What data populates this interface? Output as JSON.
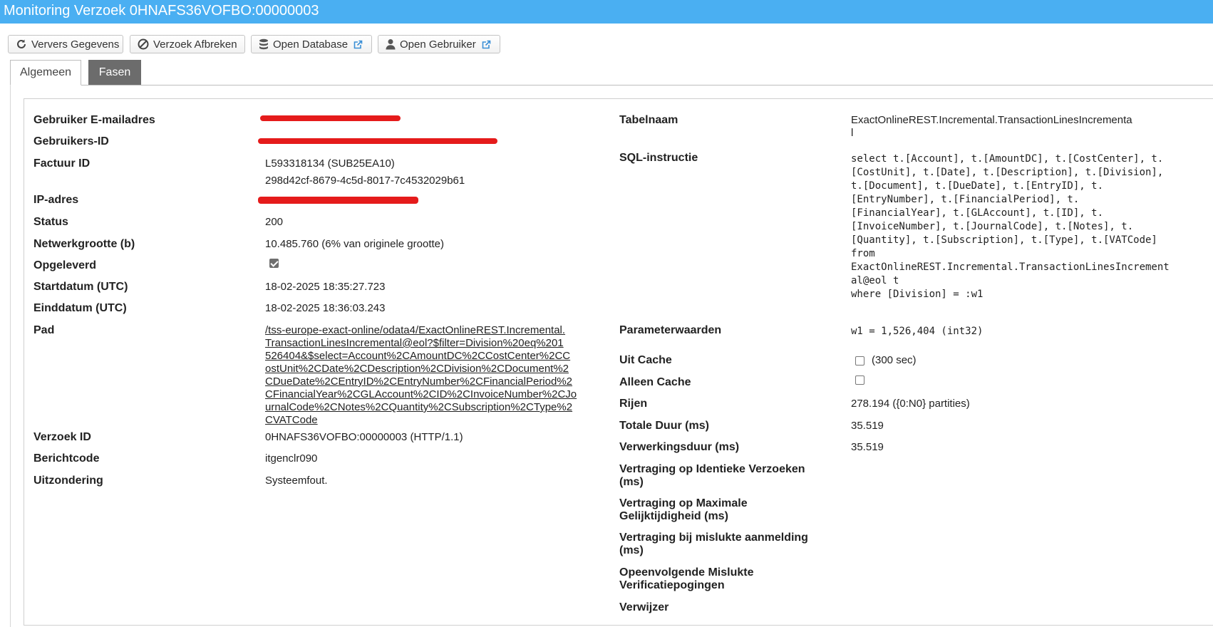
{
  "window": {
    "title": "Monitoring Verzoek 0HNAFS36VOFBO:00000003"
  },
  "toolbar": {
    "refresh_label": "Ververs Gegevens",
    "abort_label": "Verzoek Afbreken",
    "open_db_label": "Open Database",
    "open_user_label": "Open Gebruiker"
  },
  "tabs": {
    "general": "Algemeen",
    "phases": "Fasen"
  },
  "left": {
    "email_label": "Gebruiker E-mailadres",
    "userid_label": "Gebruikers-ID",
    "invoice_label": "Factuur ID",
    "invoice_line1": "L593318134 (SUB25EA10)",
    "invoice_line2": "298d42cf-8679-4c5d-8017-7c4532029b61",
    "ip_label": "IP-adres",
    "status_label": "Status",
    "status_value": "200",
    "network_label": "Netwerkgrootte (b)",
    "network_value": "10.485.760 (6% van originele grootte)",
    "delivered_label": "Opgeleverd",
    "delivered_checked": true,
    "start_label": "Startdatum (UTC)",
    "start_value": "18-02-2025 18:35:27.723",
    "end_label": "Einddatum (UTC)",
    "end_value": "18-02-2025 18:36:03.243",
    "path_label": "Pad",
    "path_lines": [
      "/tss-europe-exact-online/odata4/ExactOnlineREST.Incremental.",
      "TransactionLinesIncremental@eol?$filter=Division%20eq%201",
      "526404&$select=Account%2CAmountDC%2CCostCenter%2CC",
      "ostUnit%2CDate%2CDescription%2CDivision%2CDocument%2",
      "CDueDate%2CEntryID%2CEntryNumber%2CFinancialPeriod%2",
      "CFinancialYear%2CGLAccount%2CID%2CInvoiceNumber%2CJo",
      "urnalCode%2CNotes%2CQuantity%2CSubscription%2CType%2",
      "CVATCode"
    ],
    "request_id_label": "Verzoek ID",
    "request_id_value": "0HNAFS36VOFBO:00000003 (HTTP/1.1)",
    "msgcode_label": "Berichtcode",
    "msgcode_value": "itgenclr090",
    "exception_label": "Uitzondering",
    "exception_value": "Systeemfout."
  },
  "right": {
    "table_label": "Tabelnaam",
    "table_line1": "ExactOnlineREST.Incremental.TransactionLinesIncrementa",
    "table_line2": "l",
    "sql_label": "SQL-instructie",
    "sql_lines": [
      "select t.[Account], t.[AmountDC], t.[CostCenter], t.",
      "[CostUnit], t.[Date], t.[Description], t.[Division],",
      "t.[Document], t.[DueDate], t.[EntryID], t.",
      "[EntryNumber], t.[FinancialPeriod], t.",
      "[FinancialYear], t.[GLAccount], t.[ID], t.",
      "[InvoiceNumber], t.[JournalCode], t.[Notes], t.",
      "[Quantity], t.[Subscription], t.[Type], t.[VATCode]",
      "from",
      "ExactOnlineREST.Incremental.TransactionLinesIncrement",
      "al@eol t",
      "where  [Division] = :w1"
    ],
    "params_label": "Parameterwaarden",
    "params_value": "w1 = 1,526,404 (int32)",
    "from_cache_label": "Uit Cache",
    "from_cache_checked": false,
    "from_cache_note": "(300 sec)",
    "only_cache_label": "Alleen Cache",
    "only_cache_checked": false,
    "rows_label": "Rijen",
    "rows_value": "278.194 ({0:N0} partities)",
    "total_label": "Totale Duur (ms)",
    "total_value": "35.519",
    "processing_label": "Verwerkingsduur (ms)",
    "processing_value": "35.519",
    "delay_identical_l1": "Vertraging op Identieke Verzoeken",
    "delay_identical_l2": "(ms)",
    "delay_max_l1": "Vertraging op Maximale",
    "delay_max_l2": "Gelijktijdigheid (ms)",
    "delay_failed_l1": "Vertraging bij mislukte aanmelding",
    "delay_failed_l2": "(ms)",
    "consecutive_l1": "Opeenvolgende Mislukte",
    "consecutive_l2": "Verificatiepogingen",
    "referrer_label": "Verwijzer"
  },
  "colors": {
    "titlebar": "#4aaff2",
    "inactive_tab": "#6c6c6c",
    "redaction": "#e51b1b"
  },
  "icons": [
    "refresh-icon",
    "ban-icon",
    "database-icon",
    "user-icon",
    "external-link-icon"
  ]
}
